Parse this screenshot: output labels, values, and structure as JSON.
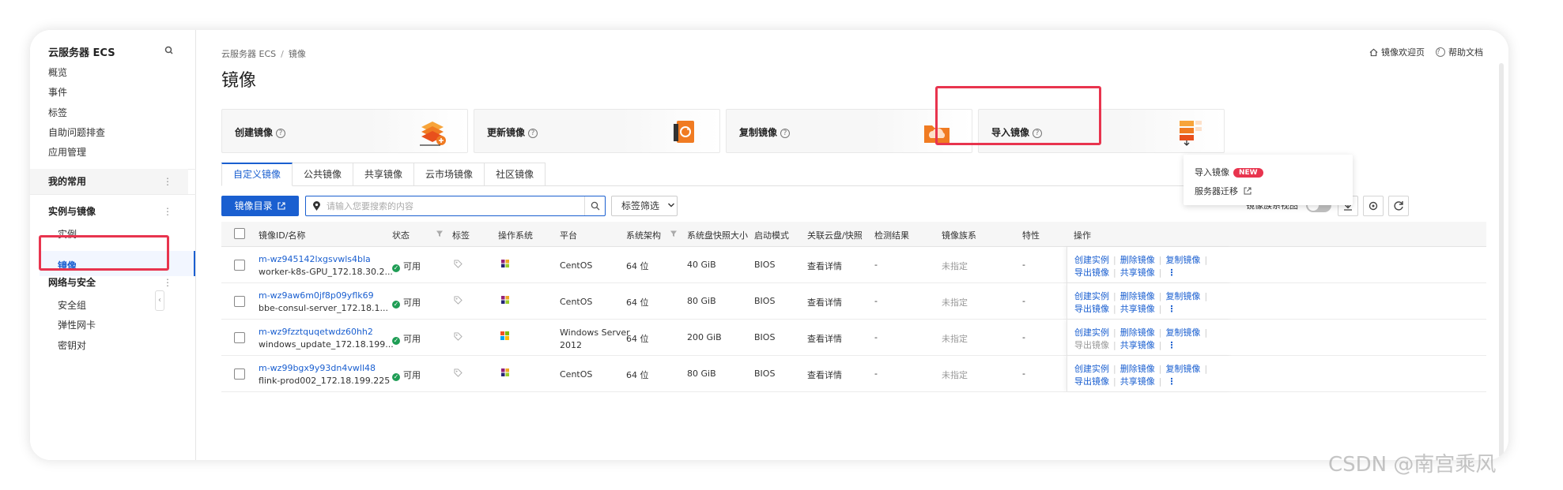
{
  "sidebar": {
    "title": "云服务器 ECS",
    "items": [
      "概览",
      "事件",
      "标签",
      "自助问题排查",
      "应用管理"
    ],
    "groups": {
      "favorites": "我的常用",
      "instances_images": "实例与镜像",
      "network": "网络与安全"
    },
    "sub_instances": [
      "实例",
      "镜像"
    ],
    "sub_network": [
      "安全组",
      "弹性网卡",
      "密钥对"
    ]
  },
  "header": {
    "breadcrumb_root": "云服务器 ECS",
    "breadcrumb_sep": "/",
    "breadcrumb_current": "镜像",
    "title": "镜像",
    "welcome_link": "镜像欢迎页",
    "help_link": "帮助文档"
  },
  "cards": [
    {
      "label": "创建镜像"
    },
    {
      "label": "更新镜像"
    },
    {
      "label": "复制镜像"
    },
    {
      "label": "导入镜像"
    }
  ],
  "import_dropdown": {
    "item1": "导入镜像",
    "badge": "NEW",
    "item2": "服务器迁移"
  },
  "tabs": [
    "自定义镜像",
    "公共镜像",
    "共享镜像",
    "云市场镜像",
    "社区镜像"
  ],
  "toolbar": {
    "catalog_button": "镜像目录",
    "search_placeholder": "请输入您要搜索的内容",
    "tag_filter": "标签筛选",
    "family_view": "镜像族系视图"
  },
  "table": {
    "headers": [
      "镜像ID/名称",
      "状态",
      "标签",
      "操作系统",
      "平台",
      "系统架构",
      "系统盘快照大小",
      "启动模式",
      "关联云盘/快照",
      "检测结果",
      "镜像族系",
      "特性",
      "操作"
    ],
    "rows": [
      {
        "id": "m-wz945142lxgsvwls4bla",
        "name": "worker-k8s-GPU_172.18.30.2...",
        "status": "可用",
        "os": "centos",
        "platform": "CentOS",
        "platform2": "",
        "arch": "64 位",
        "size": "40 GiB",
        "boot": "BIOS",
        "disk": "查看详情",
        "check": "-",
        "family": "未指定",
        "feature": "-",
        "export": "导出镜像"
      },
      {
        "id": "m-wz9aw6m0jf8p09yflk69",
        "name": "bbe-consul-server_172.18.1...",
        "status": "可用",
        "os": "centos",
        "platform": "CentOS",
        "platform2": "",
        "arch": "64 位",
        "size": "80 GiB",
        "boot": "BIOS",
        "disk": "查看详情",
        "check": "-",
        "family": "未指定",
        "feature": "-",
        "export": "导出镜像"
      },
      {
        "id": "m-wz9fzztquqetwdz60hh2",
        "name": "windows_update_172.18.199...",
        "status": "可用",
        "os": "windows",
        "platform": "Windows Server",
        "platform2": "2012",
        "arch": "64 位",
        "size": "200 GiB",
        "boot": "BIOS",
        "disk": "查看详情",
        "check": "-",
        "family": "未指定",
        "feature": "-",
        "export": "导出镜像"
      },
      {
        "id": "m-wz99bgx9y93dn4vwll48",
        "name": "flink-prod002_172.18.199.225",
        "status": "可用",
        "os": "centos",
        "platform": "CentOS",
        "platform2": "",
        "arch": "64 位",
        "size": "80 GiB",
        "boot": "BIOS",
        "disk": "查看详情",
        "check": "-",
        "family": "未指定",
        "feature": "-",
        "export": "导出镜像"
      }
    ],
    "ops": {
      "create": "创建实例",
      "delete": "删除镜像",
      "copy": "复制镜像",
      "share": "共享镜像"
    }
  },
  "watermark": "CSDN @南宫乘风",
  "colors": {
    "accent": "#1a5fd0",
    "highlight": "#e8344e",
    "success": "#1f9d55"
  }
}
